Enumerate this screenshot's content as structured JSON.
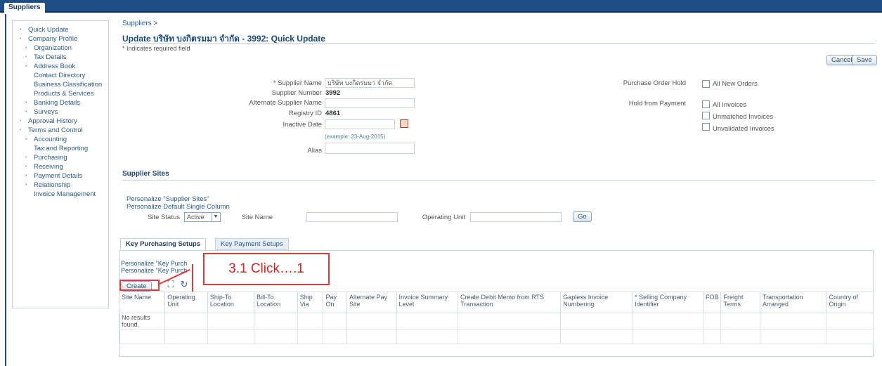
{
  "window": {
    "tab": "Suppliers"
  },
  "sidebar": {
    "items": [
      {
        "label": "Quick Update",
        "level": 1
      },
      {
        "label": "Company Profile",
        "level": 1
      },
      {
        "label": "Organization",
        "level": 2
      },
      {
        "label": "Tax Details",
        "level": 2
      },
      {
        "label": "Address Book",
        "level": 2
      },
      {
        "label": "Contact Directory",
        "level": 2,
        "wrap": true
      },
      {
        "label": "Business Classification",
        "level": 2,
        "wrap": true
      },
      {
        "label": "Products & Services",
        "level": 2,
        "wrap": true
      },
      {
        "label": "Banking Details",
        "level": 2
      },
      {
        "label": "Surveys",
        "level": 2
      },
      {
        "label": "Approval History",
        "level": 1
      },
      {
        "label": "Terms and Control",
        "level": 1
      },
      {
        "label": "Accounting",
        "level": 2
      },
      {
        "label": "Tax and Reporting",
        "level": 2,
        "wrap": true
      },
      {
        "label": "Purchasing",
        "level": 2
      },
      {
        "label": "Receiving",
        "level": 2
      },
      {
        "label": "Payment Details",
        "level": 2
      },
      {
        "label": "Relationship",
        "level": 2
      },
      {
        "label": "Invoice Management",
        "level": 2,
        "wrap": true
      }
    ]
  },
  "breadcrumb": "Suppliers >",
  "page": {
    "title": "Update บริษัท บงกิตรมมา จำกัด - 3992: Quick Update",
    "required_note": "* Indicates required field"
  },
  "buttons": {
    "cancel": "Cancel",
    "save": "Save",
    "go": "Go",
    "create": "Create"
  },
  "form": {
    "supplier_name_label": "* Supplier Name",
    "supplier_name_value": "บริษัท บงกิตรมมา จำกัด",
    "supplier_number_label": "Supplier Number",
    "supplier_number_value": "3992",
    "alt_supplier_name_label": "Alternate Supplier Name",
    "registry_id_label": "Registry ID",
    "registry_id_value": "4861",
    "inactive_date_label": "Inactive Date",
    "inactive_date_hint": "(example: 23-Aug-2015)",
    "alias_label": "Alias",
    "po_hold_label": "Purchase Order Hold",
    "all_new_orders": "All New Orders",
    "hold_from_payment_label": "Hold from Payment",
    "all_invoices": "All Invoices",
    "unmatched_invoices": "Unmatched Invoices",
    "unvalidated_invoices": "Unvalidated Invoices"
  },
  "sites": {
    "section_title": "Supplier Sites",
    "personalize_1": "Personalize \"Supplier Sites\"",
    "personalize_2": "Personalize Default Single Column",
    "site_status_label": "Site Status",
    "site_status_value": "Active",
    "site_name_label": "Site Name",
    "operating_unit_label": "Operating Unit"
  },
  "tabs": {
    "active": "Key Purchasing Setups",
    "inactive": "Key Payment Setups"
  },
  "panel": {
    "personalize_1": "Personalize \"Key Purch",
    "personalize_2": "Personalize \"Key Purch"
  },
  "table": {
    "columns": [
      "Site Name",
      "Operating Unit",
      "Ship-To Location",
      "Bill-To Location",
      "Ship Via",
      "Pay On",
      "Alternate Pay Site",
      "Invoice Summary Level",
      "Create Debit Memo from RTS Transaction",
      "Gapless Invoice Numbering",
      "* Selling Company Identifier",
      "FOB",
      "Freight Terms",
      "Transportation Arranged",
      "Country of Origin"
    ],
    "empty_text": "No results found."
  },
  "annotation": {
    "text": "3.1 Click….1"
  },
  "colors": {
    "brand": "#1e4e86",
    "callout": "#e23a3a",
    "link": "#2a5d95"
  }
}
